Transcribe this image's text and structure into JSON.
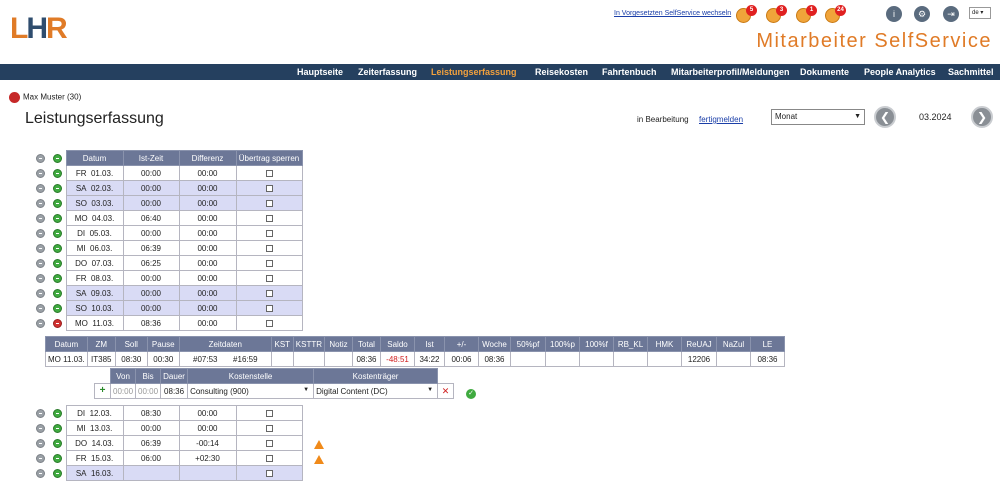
{
  "header": {
    "logo_l": "L",
    "logo_h": "H",
    "logo_r": "R",
    "supervisor_link": "In Vorgesetzten SelfService wechseln",
    "app_title": "Mitarbeiter SelfService",
    "language": "de",
    "notifications": [
      {
        "icon": "bell-icon",
        "count": "5"
      },
      {
        "icon": "clipboard-icon",
        "count": "3"
      },
      {
        "icon": "calendar-icon",
        "count": "1"
      },
      {
        "icon": "message-icon",
        "count": "24"
      }
    ],
    "tools": [
      {
        "icon": "info-icon",
        "glyph": "i"
      },
      {
        "icon": "gear-icon",
        "glyph": "⚙"
      },
      {
        "icon": "logout-icon",
        "glyph": "⇥"
      }
    ]
  },
  "nav": {
    "items": [
      "Hauptseite",
      "Zeiterfassung",
      "Leistungserfassung",
      "Reisekosten",
      "Fahrtenbuch",
      "Mitarbeiterprofil/Meldungen",
      "Dokumente",
      "People Analytics",
      "Sachmittel"
    ],
    "active": "Leistungserfassung"
  },
  "user": {
    "name": "Max Muster (30)"
  },
  "page": {
    "title": "Leistungserfassung",
    "status": "in Bearbeitung",
    "action": "fertigmelden",
    "period_select": "Monat",
    "current_month": "03.2024",
    "prev_glyph": "❮",
    "next_glyph": "❯"
  },
  "main_table": {
    "headers": [
      "Datum",
      "Ist-Zeit",
      "Differenz",
      "Übertrag sperren"
    ],
    "rows_top": [
      {
        "day": "FR",
        "date": "01.03.",
        "ist": "00:00",
        "diff": "00:00",
        "we": false
      },
      {
        "day": "SA",
        "date": "02.03.",
        "ist": "00:00",
        "diff": "00:00",
        "we": true
      },
      {
        "day": "SO",
        "date": "03.03.",
        "ist": "00:00",
        "diff": "00:00",
        "we": true
      },
      {
        "day": "MO",
        "date": "04.03.",
        "ist": "06:40",
        "diff": "00:00",
        "we": false
      },
      {
        "day": "DI",
        "date": "05.03.",
        "ist": "00:00",
        "diff": "00:00",
        "we": false
      },
      {
        "day": "MI",
        "date": "06.03.",
        "ist": "06:39",
        "diff": "00:00",
        "we": false
      },
      {
        "day": "DO",
        "date": "07.03.",
        "ist": "06:25",
        "diff": "00:00",
        "we": false
      },
      {
        "day": "FR",
        "date": "08.03.",
        "ist": "00:00",
        "diff": "00:00",
        "we": false
      },
      {
        "day": "SA",
        "date": "09.03.",
        "ist": "00:00",
        "diff": "00:00",
        "we": true
      },
      {
        "day": "SO",
        "date": "10.03.",
        "ist": "00:00",
        "diff": "00:00",
        "we": true
      },
      {
        "day": "MO",
        "date": "11.03.",
        "ist": "08:36",
        "diff": "00:00",
        "we": false,
        "expanded": true
      }
    ],
    "rows_bottom": [
      {
        "day": "DI",
        "date": "12.03.",
        "ist": "08:30",
        "diff": "00:00",
        "we": false,
        "warn": false
      },
      {
        "day": "MI",
        "date": "13.03.",
        "ist": "00:00",
        "diff": "00:00",
        "we": false,
        "warn": false
      },
      {
        "day": "DO",
        "date": "14.03.",
        "ist": "06:39",
        "diff": "-00:14",
        "we": false,
        "warn": true
      },
      {
        "day": "FR",
        "date": "15.03.",
        "ist": "06:00",
        "diff": "+02:30",
        "we": false,
        "warn": true
      },
      {
        "day": "SA",
        "date": "16.03.",
        "ist": "",
        "diff": "",
        "we": true,
        "warn": false
      }
    ]
  },
  "detail_table": {
    "headers": [
      "Datum",
      "ZM",
      "Soll",
      "Pause",
      "Zeitdaten",
      "KST",
      "KSTTR",
      "Notiz",
      "Total",
      "Saldo",
      "Ist",
      "+/-",
      "Woche",
      "50%pf",
      "100%p",
      "100%f",
      "RB_KL",
      "HMK",
      "ReUAJ",
      "NaZul",
      "LE"
    ],
    "row": {
      "datum": "MO 11.03.",
      "zm": "IT385",
      "soll": "08:30",
      "pause": "00:30",
      "zeit_von": "#07:53",
      "zeit_bis": "#16:59",
      "kst": "",
      "ksttr": "",
      "notiz": "",
      "total": "08:36",
      "saldo": "-48:51",
      "ist": "34:22",
      "plusminus": "00:06",
      "woche": "08:36",
      "p50": "",
      "p100p": "",
      "p100f": "",
      "rbkl": "",
      "hmk": "",
      "reuaj": "12206",
      "nazul": "",
      "le": "08:36"
    }
  },
  "edit_table": {
    "headers": [
      "Von",
      "Bis",
      "Dauer",
      "Kostenstelle",
      "Kostenträger"
    ],
    "row": {
      "von": "00:00",
      "bis": "00:00",
      "dauer": "08:36",
      "kostenstelle": "Consulting (900)",
      "kostentraeger": "Digital Content (DC)"
    }
  }
}
